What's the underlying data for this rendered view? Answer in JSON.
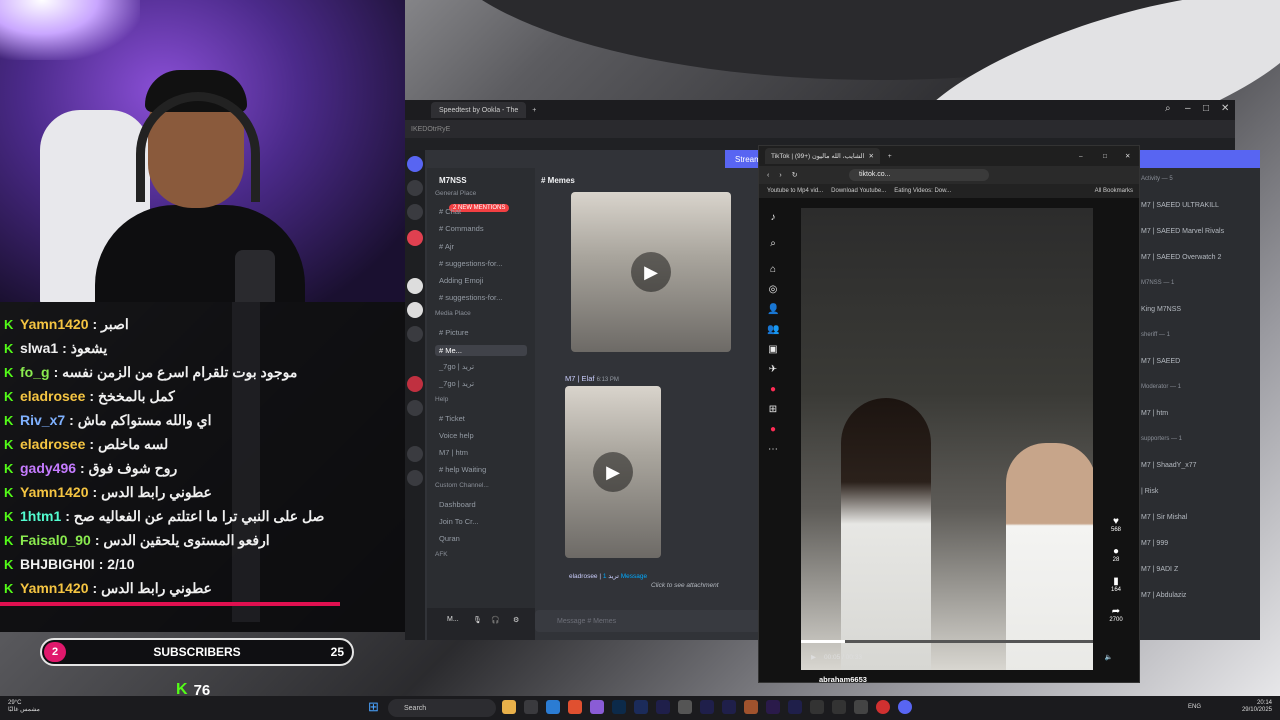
{
  "chat": {
    "messages": [
      {
        "user": "Yamn1420",
        "color": "#f5c542",
        "text": ": اصبر"
      },
      {
        "user": "slwa1",
        "color": "#f0f0f0",
        "text": ": يشعوذ"
      },
      {
        "user": "fo_g",
        "color": "#8aeb4f",
        "text": ": موجود بوت تلقرام اسرع من الزمن نفسه"
      },
      {
        "user": "eladrosee",
        "color": "#f5c542",
        "text": ": كمل بالمخخخ"
      },
      {
        "user": "Riv_x7",
        "color": "#7fb1ff",
        "text": ": اي والله مستواكم ماش"
      },
      {
        "user": "eladrosee",
        "color": "#f5c542",
        "text": ": لسه ماخلص"
      },
      {
        "user": "gady496",
        "color": "#c57bff",
        "text": ": روح شوف فوق"
      },
      {
        "user": "Yamn1420",
        "color": "#f5c542",
        "text": ": عطوني رابط الدس"
      },
      {
        "user": "1htm1",
        "color": "#53fcd0",
        "text": ": صل على النبي ترا ما اعتلتم عن الفعاليه صح"
      },
      {
        "user": "Faisal0_90",
        "color": "#8aeb4f",
        "text": ": ارفعو المستوى يلحقين الدس"
      },
      {
        "user": "BHJBIGH0I",
        "color": "#f0f0f0",
        "text": ": 2/10"
      },
      {
        "user": "Yamn1420",
        "color": "#f5c542",
        "text": ": عطوني رابط الدس"
      }
    ]
  },
  "subs": {
    "count": "2",
    "label": "SUBSCRIBERS",
    "goal": "25"
  },
  "viewers": {
    "count": "76"
  },
  "browser": {
    "tab_title": "Speedtest by Ookla - The",
    "url": "IKEDOtrRyE"
  },
  "discord": {
    "topbar": "Stream",
    "guild": "M7NSS",
    "mentions": "2 NEW MENTIONS",
    "current_channel": "Memes",
    "channels": [
      {
        "label": "General Place",
        "cat": true
      },
      {
        "label": "# Chat"
      },
      {
        "label": "# Commands"
      },
      {
        "label": "# Ajr"
      },
      {
        "label": "# suggestions-for..."
      },
      {
        "label": "Adding Emoji"
      },
      {
        "label": "# suggestions-for..."
      },
      {
        "label": "Media Place",
        "cat": true
      },
      {
        "label": "# Picture"
      },
      {
        "label": "# Me...",
        "active": true
      },
      {
        "label": "_7go | تريد"
      },
      {
        "label": "_7go | تريد"
      },
      {
        "label": "Help",
        "cat": true
      },
      {
        "label": "# Ticket"
      },
      {
        "label": "Voice help"
      },
      {
        "label": "M7 | htm"
      },
      {
        "label": "# help Waiting"
      },
      {
        "label": "Custom Channel...",
        "cat": true
      },
      {
        "label": "Dashboard"
      },
      {
        "label": "Join To Cr..."
      },
      {
        "label": "Quran"
      },
      {
        "label": "AFK",
        "cat": true
      }
    ],
    "msg_author": "M7 | Elaf",
    "msg_time": "6:13 PM",
    "reply_author": "eladrosee | تريد",
    "reply_text": "1 Message",
    "attach_hint": "Click to see attachment",
    "input_placeholder": "Message # Memes",
    "user_name": "M...",
    "members": [
      {
        "label": "Activity — 5",
        "cat": true
      },
      {
        "label": "M7 | SAEED  ULTRAKILL"
      },
      {
        "label": "M7 | SAEED  Marvel Rivals"
      },
      {
        "label": "M7 | SAEED  Overwatch 2"
      },
      {
        "label": "M7NSS — 1",
        "cat": true
      },
      {
        "label": "King M7NSS"
      },
      {
        "label": "sheriff — 1",
        "cat": true
      },
      {
        "label": "M7 | SAEED"
      },
      {
        "label": "Moderator — 1",
        "cat": true
      },
      {
        "label": "M7 | htm"
      },
      {
        "label": "supporters — 1",
        "cat": true
      },
      {
        "label": "M7 | ShaadY_x77"
      },
      {
        "label": "| Risk"
      },
      {
        "label": "M7 | Sir Mishal"
      },
      {
        "label": "M7 | 999"
      },
      {
        "label": "M7 | 9ADI Z"
      },
      {
        "label": "M7 | Abdulaziz"
      }
    ]
  },
  "tiktok": {
    "tab_title": "TikTok | الشايب، الله ماليون (+99)",
    "url": "tiktok.co...",
    "bookmarks": [
      "Youtube to Mp4 vid...",
      "Download Youtube...",
      "Eating Videos: Dow...",
      "All Bookmarks"
    ],
    "time": "00:05 / 00:33",
    "actions": [
      "568",
      "28",
      "164",
      "2700"
    ],
    "author": "abraham6653"
  },
  "taskbar": {
    "weather_temp": "29°C",
    "weather_desc": "مشمس غالبًا",
    "search": "Search",
    "lang": "ENG",
    "time": "20:14",
    "date": "29/10/2025"
  }
}
